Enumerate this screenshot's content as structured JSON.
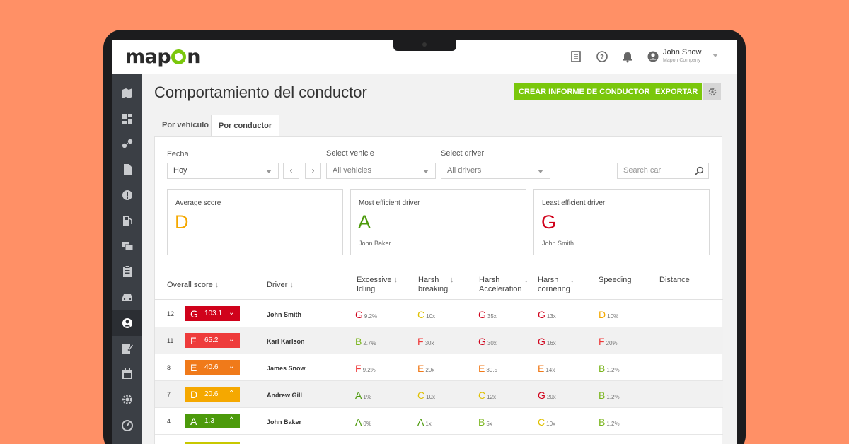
{
  "brand": {
    "logo_pre": "map",
    "logo_post": "n"
  },
  "header": {
    "user_name": "John Snow",
    "user_company": "Mapon Company",
    "icons": [
      "document-icon",
      "help-icon",
      "bell-icon",
      "user-icon"
    ]
  },
  "sidebar": {
    "icons": [
      "map-icon",
      "dashboard-icon",
      "route-icon",
      "file-icon",
      "alert-icon",
      "fuel-icon",
      "messages-icon",
      "clipboard-icon",
      "car-icon",
      "driver-icon",
      "edit-icon",
      "calendar-icon",
      "settings-icon",
      "gauge-icon"
    ],
    "active_index": 9
  },
  "page": {
    "title": "Comportamiento del conductor",
    "btn_create": "CREAR INFORME DE CONDUCTOR",
    "btn_export": "EXPORTAR"
  },
  "tabs": [
    "Por vehículo",
    "Por conductor"
  ],
  "filters": {
    "date_label": "Fecha",
    "date_value": "Hoy",
    "vehicle_label": "Select vehicle",
    "vehicle_value": "All vehicles",
    "driver_label": "Select driver",
    "driver_value": "All drivers",
    "search_placeholder": "Search car",
    "prev": "‹",
    "next": "›"
  },
  "cards": [
    {
      "title": "Average score",
      "grade": "D",
      "color": "#F5A800",
      "name": ""
    },
    {
      "title": "Most efficient driver",
      "grade": "A",
      "color": "#4C9A0B",
      "name": "John Baker"
    },
    {
      "title": "Least efficient driver",
      "grade": "G",
      "color": "#D0021B",
      "name": "John Smith"
    }
  ],
  "table": {
    "headers": {
      "overall": "Overall score",
      "driver": "Driver",
      "idling": [
        "Excessive",
        "Idling"
      ],
      "breaking": [
        "Harsh",
        "breaking"
      ],
      "accel": [
        "Harsh",
        "Acceleration"
      ],
      "cornering": [
        "Harsh",
        "cornering"
      ],
      "speeding": "Speeding",
      "distance": "Distance",
      "sort_arrow": "↓"
    },
    "grade_colors": {
      "A": "#4C9A0B",
      "B": "#7AB51D",
      "C": "#E0C000",
      "D": "#F5A800",
      "E": "#F07A1A",
      "F": "#EE3B3B",
      "G": "#D0021B"
    },
    "rows": [
      {
        "rank": "12",
        "grade": "G",
        "score": "103.1",
        "chevron": "⌄",
        "driver": "John Smith",
        "cells": [
          [
            "G",
            "9.2%"
          ],
          [
            "C",
            "10x"
          ],
          [
            "G",
            "35x"
          ],
          [
            "G",
            "13x"
          ],
          [
            "D",
            "10%"
          ]
        ]
      },
      {
        "rank": "11",
        "grade": "F",
        "score": "65.2",
        "chevron": "⌄",
        "driver": "Karl Karlson",
        "cells": [
          [
            "B",
            "2.7%"
          ],
          [
            "F",
            "30x"
          ],
          [
            "G",
            "30x"
          ],
          [
            "G",
            "16x"
          ],
          [
            "F",
            "20%"
          ]
        ]
      },
      {
        "rank": "8",
        "grade": "E",
        "score": "40.6",
        "chevron": "⌄",
        "driver": "James Snow",
        "cells": [
          [
            "F",
            "9.2%"
          ],
          [
            "E",
            "20x"
          ],
          [
            "E",
            "30.5"
          ],
          [
            "E",
            "14x"
          ],
          [
            "B",
            "1.2%"
          ]
        ]
      },
      {
        "rank": "7",
        "grade": "D",
        "score": "20.6",
        "chevron": "⌃",
        "driver": "Andrew Gill",
        "cells": [
          [
            "A",
            "1%"
          ],
          [
            "C",
            "10x"
          ],
          [
            "C",
            "12x"
          ],
          [
            "G",
            "20x"
          ],
          [
            "B",
            "1.2%"
          ]
        ]
      },
      {
        "rank": "4",
        "grade": "A",
        "score": "1.3",
        "chevron": "⌃",
        "driver": "John Baker",
        "cells": [
          [
            "A",
            "0%"
          ],
          [
            "A",
            "1x"
          ],
          [
            "B",
            "5x"
          ],
          [
            "C",
            "10x"
          ],
          [
            "B",
            "1.2%"
          ]
        ]
      }
    ]
  }
}
